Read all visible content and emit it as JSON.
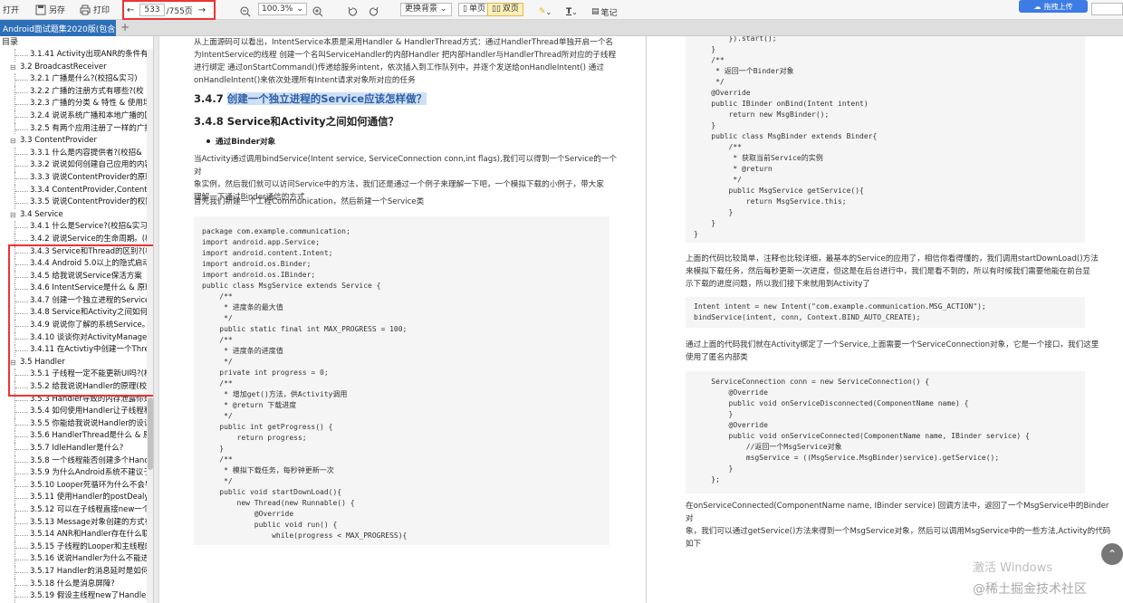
{
  "toolbar": {
    "open_label": "打开",
    "saveas_label": "另存",
    "print_label": "打印",
    "page_current": "533",
    "page_total": "/755页",
    "zoom_value": "100.3%",
    "bg_label": "更换背景",
    "single_page_label": "单页",
    "double_page_label": "双页",
    "note_label": "笔记",
    "upload_label": "拖拽上传"
  },
  "tab": {
    "title": "Android面试题集2020版(包含",
    "close": "×",
    "add": "+"
  },
  "sidebar": {
    "title": "目录",
    "items": [
      {
        "level": 2,
        "text": "3.1.41 Activity出现ANR的条件有哪"
      },
      {
        "level": 1,
        "text": "3.2 BroadcastReceiver"
      },
      {
        "level": 2,
        "text": "3.2.1 广播是什么?(校招&实习)"
      },
      {
        "level": 2,
        "text": "3.2.2 广播的注册方式有哪些?(校"
      },
      {
        "level": 2,
        "text": "3.2.3 广播的分类 & 特性 & 使用场"
      },
      {
        "level": 2,
        "text": "3.2.4 说说系统广播和本地广播的区"
      },
      {
        "level": 2,
        "text": "3.2.5 有两个应用注册了一样的广播"
      },
      {
        "level": 1,
        "text": "3.3 ContentProvider"
      },
      {
        "level": 2,
        "text": "3.3.1 什么是内容提供者?(校招&"
      },
      {
        "level": 2,
        "text": "3.3.2 说说如何创建自己应用的内容"
      },
      {
        "level": 2,
        "text": "3.3.3 说说ContentProvider的原理"
      },
      {
        "level": 2,
        "text": "3.3.4 ContentProvider,ContentR"
      },
      {
        "level": 2,
        "text": "3.3.5 说说ContentProvider的权限"
      },
      {
        "level": 1,
        "text": "3.4 Service"
      },
      {
        "level": 2,
        "text": "3.4.1 什么是Service?(校招&实习)"
      },
      {
        "level": 2,
        "text": "3.4.2 说说Service的生命周期。(校"
      },
      {
        "level": 2,
        "text": "3.4.3 Service和Thread的区别?(校"
      },
      {
        "level": 2,
        "text": "3.4.4 Android 5.0以上的隐式启动"
      },
      {
        "level": 2,
        "text": "3.4.5 给我说说Service保活方案"
      },
      {
        "level": 2,
        "text": "3.4.6 IntentService是什么 & 原理"
      },
      {
        "level": 2,
        "text": "3.4.7 创建一个独立进程的Service"
      },
      {
        "level": 2,
        "text": "3.4.8 Service和Activity之间如何通"
      },
      {
        "level": 2,
        "text": "3.4.9 说说你了解的系统Service。"
      },
      {
        "level": 2,
        "text": "3.4.10 谈谈你对ActivityManager的"
      },
      {
        "level": 2,
        "text": "3.4.11 在Activtiy中创建一个Thread"
      },
      {
        "level": 1,
        "text": "3.5 Handler"
      },
      {
        "level": 2,
        "text": "3.5.1 子线程一定不能更新UI吗?(校"
      },
      {
        "level": 2,
        "text": "3.5.2 给我说说Handler的原理(校招"
      },
      {
        "level": 2,
        "text": "3.5.3 Handler导致的内存泄露你是"
      },
      {
        "level": 2,
        "text": "3.5.4 如何使用Handler让子线程和"
      },
      {
        "level": 2,
        "text": "3.5.5 你能给我说说Handler的设计"
      },
      {
        "level": 2,
        "text": "3.5.6 HandlerThread是什么 & 原"
      },
      {
        "level": 2,
        "text": "3.5.7 IdleHandler是什么?"
      },
      {
        "level": 2,
        "text": "3.5.8 一个线程能否创建多个Handl"
      },
      {
        "level": 2,
        "text": "3.5.9 为什么Android系统不建议子"
      },
      {
        "level": 2,
        "text": "3.5.10 Looper死循环为什么不会导"
      },
      {
        "level": 2,
        "text": "3.5.11 使用Handler的postDealy后"
      },
      {
        "level": 2,
        "text": "3.5.12 可以在子线程直接new一个H"
      },
      {
        "level": 2,
        "text": "3.5.13 Message对象创建的方式有"
      },
      {
        "level": 2,
        "text": "3.5.14 ANR和Handler存在什么联"
      },
      {
        "level": 2,
        "text": "3.5.15 子线程的Looper和主线程的"
      },
      {
        "level": 2,
        "text": "3.5.16 说说Handler为什么不能进"
      },
      {
        "level": 2,
        "text": "3.5.17 Handler的消息延时是如何实"
      },
      {
        "level": 2,
        "text": "3.5.18 什么是消息屏障?"
      },
      {
        "level": 2,
        "text": "3.5.19 假设主线程new了Handler"
      }
    ]
  },
  "left_page": {
    "intro": [
      "从上面源码可以看出，IntentService本质是采用Handler & HandlerThread方式：通过HandlerThread单独开启一个名",
      "为IntentService的线程 创建一个名叫ServiceHandler的内部Handler 把内部Handler与HandlerThread所对应的子线程",
      "进行绑定 通过onStartCommand()传递给服务intent，依次插入到工作队列中，并逐个发送给onHandleIntent() 通过",
      "onHandleIntent()来依次处理所有Intent请求对象所对应的任务"
    ],
    "h347_num": "3.4.7",
    "h347_title": "创建一个独立进程的Service应该怎样做？",
    "h348": "3.4.8 Service和Activity之间如何通信？",
    "bullet": "通过Binder对象",
    "para1": [
      "当Activity通过调用bindService(Intent service, ServiceConnection conn,int flags),我们可以得到一个Service的一个对",
      "象实例，然后我们就可以访问Service中的方法，我们还是通过一个例子来理解一下吧，一个模拟下载的小例子，带大家",
      "理解一下通过Binder通信的方式"
    ],
    "para2": "首先我们新建一个工程Communication，然后新建一个Service类",
    "code": [
      "package com.example.communication;",
      "import android.app.Service;",
      "import android.content.Intent;",
      "import android.os.Binder;",
      "import android.os.IBinder;",
      "public class MsgService extends Service {",
      "    /**",
      "     * 进度条的最大值",
      "     */",
      "    public static final int MAX_PROGRESS = 100;",
      "    /**",
      "     * 进度条的进度值",
      "     */",
      "    private int progress = 0;",
      "    /**",
      "     * 增加get()方法，供Activity调用",
      "     * @return 下载进度",
      "     */",
      "    public int getProgress() {",
      "        return progress;",
      "    }",
      "    /**",
      "     * 模拟下载任务，每秒钟更新一次",
      "     */",
      "    public void startDownLoad(){",
      "        new Thread(new Runnable() {",
      "            @Override",
      "            public void run() {",
      "                while(progress < MAX_PROGRESS){"
    ]
  },
  "right_page": {
    "code1": [
      "        }).start();",
      "    }",
      "    /**",
      "     * 返回一个Binder对象",
      "     */",
      "    @Override",
      "    public IBinder onBind(Intent intent)",
      "        return new MsgBinder();",
      "    }",
      "    public class MsgBinder extends Binder{",
      "        /**",
      "         * 获取当前Service的实例",
      "         * @return",
      "         */",
      "        public MsgService getService(){",
      "            return MsgService.this;",
      "        }",
      "    }",
      "}"
    ],
    "para1": [
      "上面的代码比较简单，注释也比较详细，最基本的Service的应用了，相信你看得懂的，我们调用startDownLoad()方法",
      "来模拟下载任务，然后每秒更新一次进度，但这是在后台进行中，我们是看不到的，所以有时候我们需要他能在前台显",
      "示下载的进度问题，所以我们接下来就用到Activity了"
    ],
    "code2": [
      "Intent intent = new Intent(\"com.example.communication.MSG_ACTION\");",
      "bindService(intent, conn, Context.BIND_AUTO_CREATE);"
    ],
    "para2": [
      "通过上面的代码我们就在Activity绑定了一个Service,上面需要一个ServiceConnection对象，它是一个接口，我们这里",
      "使用了匿名内部类"
    ],
    "code3": [
      "    ServiceConnection conn = new ServiceConnection() {",
      "        @Override",
      "        public void onServiceDisconnected(ComponentName name) {",
      "        }",
      "        @Override",
      "        public void onServiceConnected(ComponentName name, IBinder service) {",
      "            //返回一个MsgService对象",
      "            msgService = ((MsgService.MsgBinder)service).getService();",
      "        }",
      "    };"
    ],
    "para3": [
      "在onServiceConnected(ComponentName name, IBinder service) 回调方法中，返回了一个MsgService中的Binder对",
      "象，我们可以通过getService()方法来得到一个MsgService对象，然后可以调用MsgService中的一些方法,Activity的代码",
      "如下"
    ]
  },
  "overlay": {
    "scroll_top": "⌃",
    "watermark1": "激活 Windows",
    "watermark2": "@稀土掘金技术社区"
  },
  "colors": {
    "accent": "#2d6fb8",
    "highlight_red": "#e33333",
    "heading_highlight": "#cfe0f6",
    "code_bg": "#f5f5f5"
  }
}
